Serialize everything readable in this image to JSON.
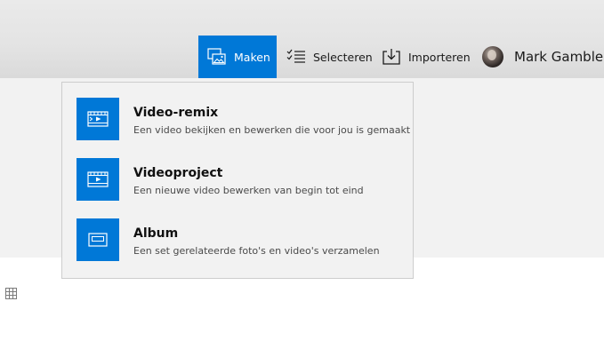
{
  "toolbar": {
    "create_label": "Maken",
    "select_label": "Selecteren",
    "import_label": "Importeren",
    "user_name": "Mark Gamble"
  },
  "create_menu": {
    "items": [
      {
        "title": "Video-remix",
        "description": "Een video bekijken en bewerken die voor jou is gemaakt",
        "icon": "video-remix-icon"
      },
      {
        "title": "Videoproject",
        "description": "Een nieuwe video bewerken van begin tot eind",
        "icon": "video-project-icon"
      },
      {
        "title": "Album",
        "description": "Een set gerelateerde foto's en video's verzamelen",
        "icon": "album-icon"
      }
    ]
  },
  "colors": {
    "accent": "#0078d7",
    "menu_background": "#f2f2f2",
    "toolbar_background": "#e4e4e4"
  }
}
